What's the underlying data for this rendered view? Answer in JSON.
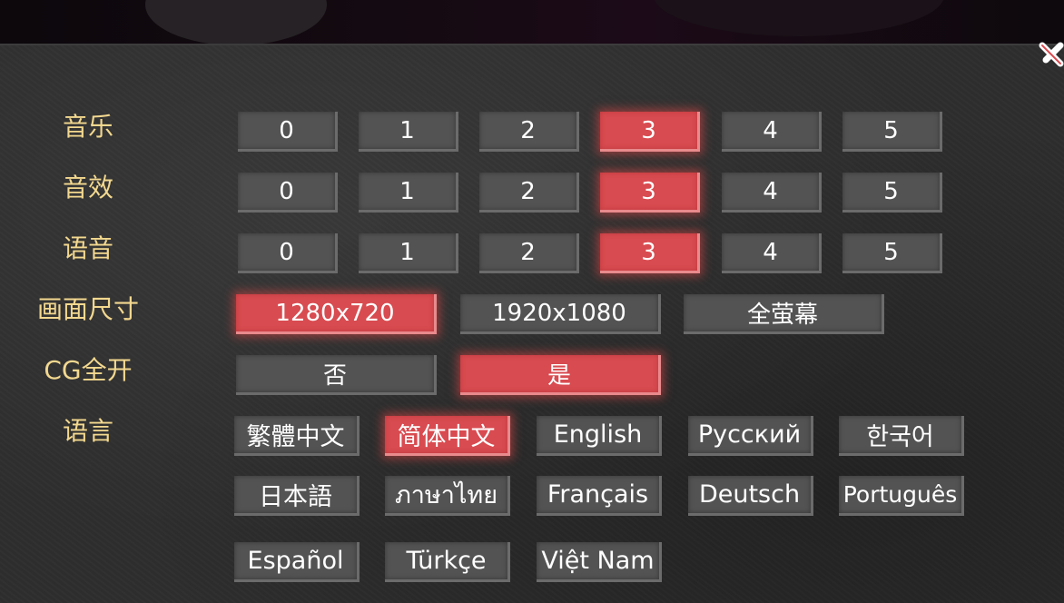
{
  "settings": {
    "rows": [
      {
        "label": "音乐",
        "options": [
          "0",
          "1",
          "2",
          "3",
          "4",
          "5"
        ],
        "selected": "3"
      },
      {
        "label": "音效",
        "options": [
          "0",
          "1",
          "2",
          "3",
          "4",
          "5"
        ],
        "selected": "3"
      },
      {
        "label": "语音",
        "options": [
          "0",
          "1",
          "2",
          "3",
          "4",
          "5"
        ],
        "selected": "3"
      },
      {
        "label": "画面尺寸",
        "options": [
          "1280x720",
          "1920x1080",
          "全萤幕"
        ],
        "selected": "1280x720"
      },
      {
        "label": "CG全开",
        "options": [
          "否",
          "是"
        ],
        "selected": "是"
      },
      {
        "label": "语言",
        "options": [
          "繁體中文",
          "简体中文",
          "English",
          "Русский",
          "한국어",
          "日本語",
          "ภาษาไทย",
          "Français",
          "Deutsch",
          "Português",
          "Español",
          "Türkçe",
          "Việt Nam"
        ],
        "selected": "简体中文"
      }
    ]
  },
  "colors": {
    "label_text": "#f3d88f",
    "button_normal": "#535353",
    "button_selected": "#d84b50",
    "panel_background": "#2e2e2e"
  },
  "icons": {
    "close": "close-x-icon"
  }
}
